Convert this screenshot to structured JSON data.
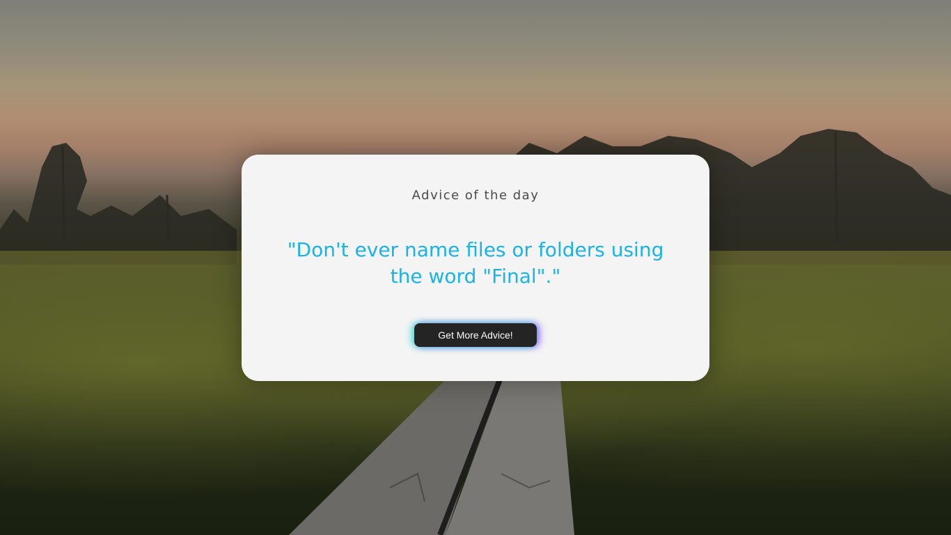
{
  "card": {
    "title": "Advice of the day",
    "advice": "\"Don't ever name files or folders using the word \"Final\".\"",
    "button_label": "Get More Advice!"
  },
  "colors": {
    "card_background": "#f4f4f4",
    "advice_text": "#1ab3e8",
    "button_background": "#242424",
    "button_text": "#ffffff"
  }
}
